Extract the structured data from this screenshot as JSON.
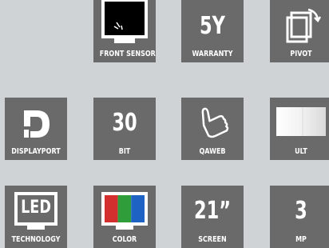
{
  "colors": {
    "page_background": "#cfd3d6",
    "tile_background": "#6a6a6a",
    "foreground": "#ffffff"
  },
  "tiles": {
    "front_sensor": {
      "caption": "FRONT SENSOR",
      "icon": "monitor-sensor-icon"
    },
    "warranty": {
      "value": "5Y",
      "caption": "WARRANTY"
    },
    "pivot": {
      "caption": "PIVOT",
      "icon": "pivot-rotate-icon"
    },
    "displayport": {
      "caption": "DISPLAYPORT",
      "icon": "displayport-logo-icon"
    },
    "bit": {
      "value": "30",
      "caption": "BIT"
    },
    "qaweb": {
      "caption": "QAWEB",
      "icon": "thumbs-up-icon"
    },
    "ult": {
      "caption": "ULT",
      "icon": "uniform-luminance-icon"
    },
    "led_technology": {
      "icon_text": "LED",
      "caption": "TECHNOLOGY",
      "icon": "led-monitor-icon"
    },
    "color": {
      "caption": "COLOR",
      "icon": "color-monitor-icon",
      "stripe_colors": [
        "#d32f2f",
        "#2e9d3a",
        "#1e63c4"
      ]
    },
    "screen": {
      "value": "21”",
      "caption": "SCREEN"
    },
    "mp": {
      "value": "3",
      "caption": "MP"
    }
  }
}
